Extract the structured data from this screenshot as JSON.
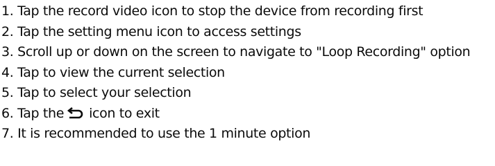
{
  "steps": {
    "step1": "1. Tap the record video icon to stop the device from recording first",
    "step2": "2. Tap the setting menu icon to access settings",
    "step3": "3. Scroll up or down on the screen to navigate to \"Loop Recording\" option",
    "step4": "4. Tap to view the current selection",
    "step5": "5. Tap to select your selection",
    "step6_before": "6. Tap the",
    "step6_icon": "back-arrow-icon",
    "step6_after": "icon to exit",
    "step7": "7. It is recommended to use the 1 minute option"
  }
}
